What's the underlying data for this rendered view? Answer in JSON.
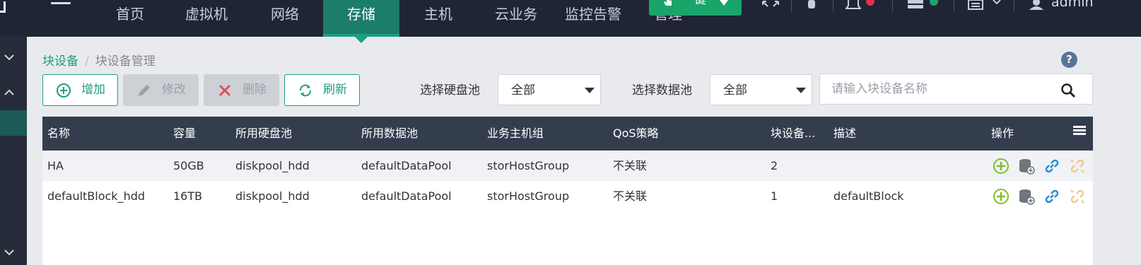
{
  "nav": {
    "items": [
      "首页",
      "虚拟机",
      "网络",
      "存储",
      "主机",
      "云业务",
      "监控告警"
    ],
    "active": "存储",
    "manage_label": "管理",
    "onekey_label": "一键",
    "user": "admin"
  },
  "breadcrumb": {
    "root": "块设备",
    "separator": "/",
    "current": "块设备管理"
  },
  "help_label": "?",
  "toolbar": {
    "add_label": "增加",
    "edit_label": "修改",
    "delete_label": "删除",
    "refresh_label": "刷新"
  },
  "filters": {
    "diskpool_label": "选择硬盘池",
    "diskpool_value": "全部",
    "datapool_label": "选择数据池",
    "datapool_value": "全部",
    "search_placeholder": "请输入块设备名称"
  },
  "table": {
    "headers": [
      "名称",
      "容量",
      "所用硬盘池",
      "所用数据池",
      "业务主机组",
      "QoS策略",
      "块设备...",
      "描述",
      "操作"
    ],
    "rows": [
      [
        "HA",
        "50GB",
        "diskpool_hdd",
        "defaultDataPool",
        "storHostGroup",
        "不关联",
        "2",
        ""
      ],
      [
        "defaultBlock_hdd",
        "16TB",
        "diskpool_hdd",
        "defaultDataPool",
        "storHostGroup",
        "不关联",
        "1",
        "defaultBlock"
      ]
    ]
  },
  "colors": {
    "nav_bg": "#1f2535",
    "accent": "#1f9c82",
    "table_header_bg": "#333d4e",
    "onekey_green": "#1aa46a"
  }
}
